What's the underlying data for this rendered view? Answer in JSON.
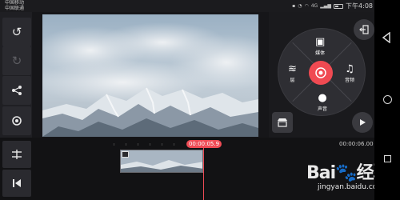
{
  "status_bar": {
    "carrier_line1": "中国移动",
    "carrier_line2": "中国联通",
    "signal_text": "4G",
    "time": "下午4:08"
  },
  "left_toolbar": {
    "items": [
      {
        "name": "undo-icon",
        "glyph": "↺"
      },
      {
        "name": "redo-icon",
        "glyph": "↻"
      },
      {
        "name": "share-icon",
        "glyph": "⋖"
      },
      {
        "name": "settings-icon",
        "glyph": "◎"
      }
    ]
  },
  "media_wheel": {
    "media_label": "媒体",
    "layer_label": "层",
    "audio_label": "音频",
    "voice_label": "声音",
    "accent_color": "#f04a52"
  },
  "right_panel": {
    "export_icon": "export-icon",
    "store_icon": "store-icon",
    "play_icon": "play-icon"
  },
  "timeline": {
    "current_time": "00:00:05.9",
    "total_time": "00:00:06.00",
    "clip_icon": "image-icon"
  },
  "watermark": {
    "logo_text": "Bai",
    "logo_text2": "经验",
    "url": "jingyan.baidu.com"
  }
}
